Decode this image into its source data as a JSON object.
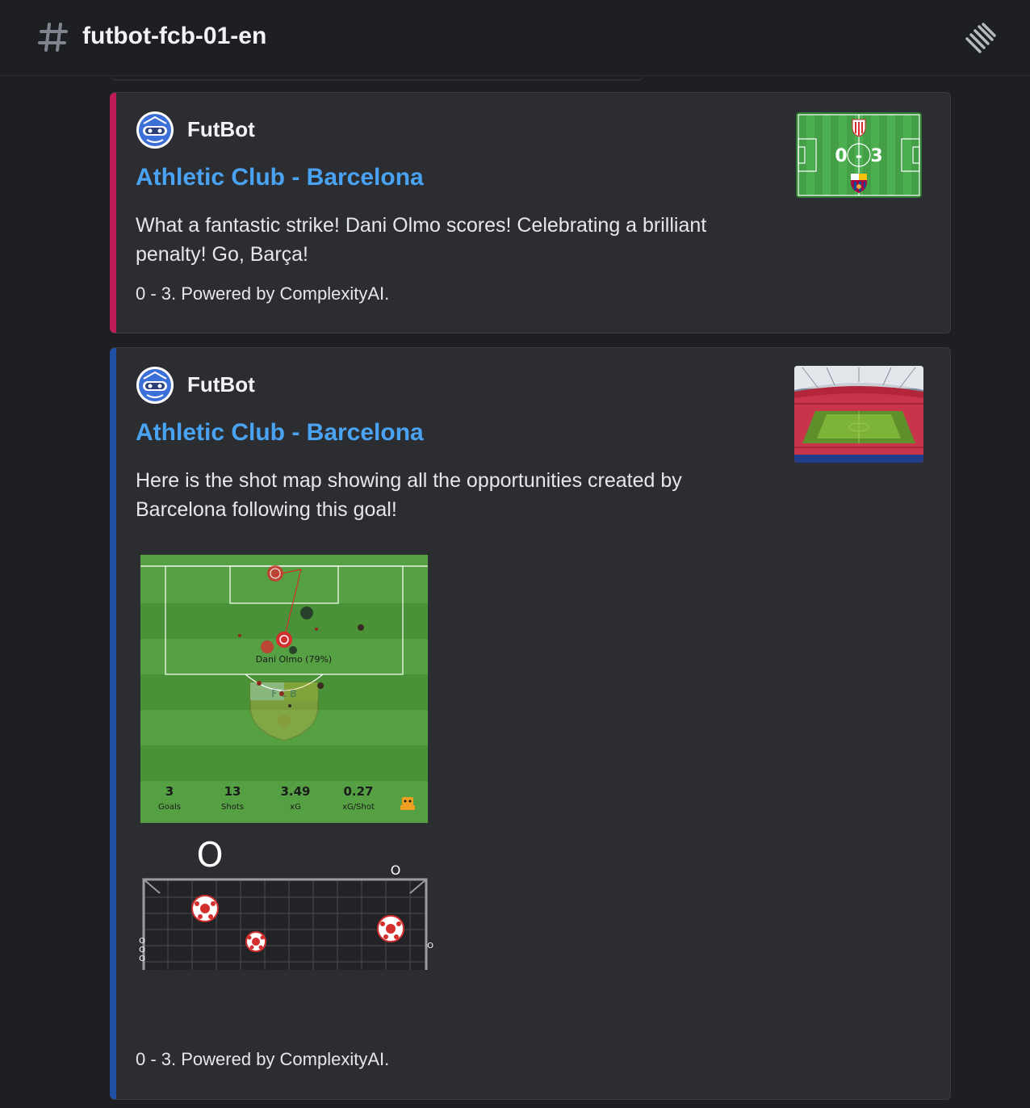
{
  "header": {
    "channel_name": "futbot-fcb-01-en",
    "hash_icon": "hash-icon",
    "threads_icon": "threads-icon"
  },
  "messages": [
    {
      "accent_color": "#c01c57",
      "author": "FutBot",
      "title": "Athletic Club - Barcelona",
      "description": "What a fantastic strike! Dani Olmo scores! Celebrating a brilliant penalty! Go, Barça!",
      "footer": "0 - 3. Powered by ComplexityAI.",
      "thumbnail": {
        "home_score": "0",
        "separator": "-",
        "away_score": "3"
      }
    },
    {
      "accent_color": "#1d4fa3",
      "author": "FutBot",
      "title": "Athletic Club - Barcelona",
      "description": "Here is the shot map showing all the opportunities created by Barcelona following this goal!",
      "footer": "0 - 3. Powered by ComplexityAI.",
      "shot_map": {
        "label": "Dani Olmo (79%)",
        "crest_text": "F C B",
        "stats": [
          {
            "value": "3",
            "label": "Goals"
          },
          {
            "value": "13",
            "label": "Shots"
          },
          {
            "value": "3.49",
            "label": "xG"
          },
          {
            "value": "0.27",
            "label": "xG/Shot"
          }
        ],
        "goal_big_label": "O",
        "goal_small_label": "O",
        "goal_right_label": "O",
        "goal_left_labels": [
          "O",
          "O",
          "O"
        ]
      }
    }
  ],
  "colors": {
    "background": "#1e1f22",
    "embed_bg": "#2b2d31",
    "link": "#4aa3f2",
    "pitch_light": "#54a043",
    "pitch_dark": "#4a9238"
  }
}
